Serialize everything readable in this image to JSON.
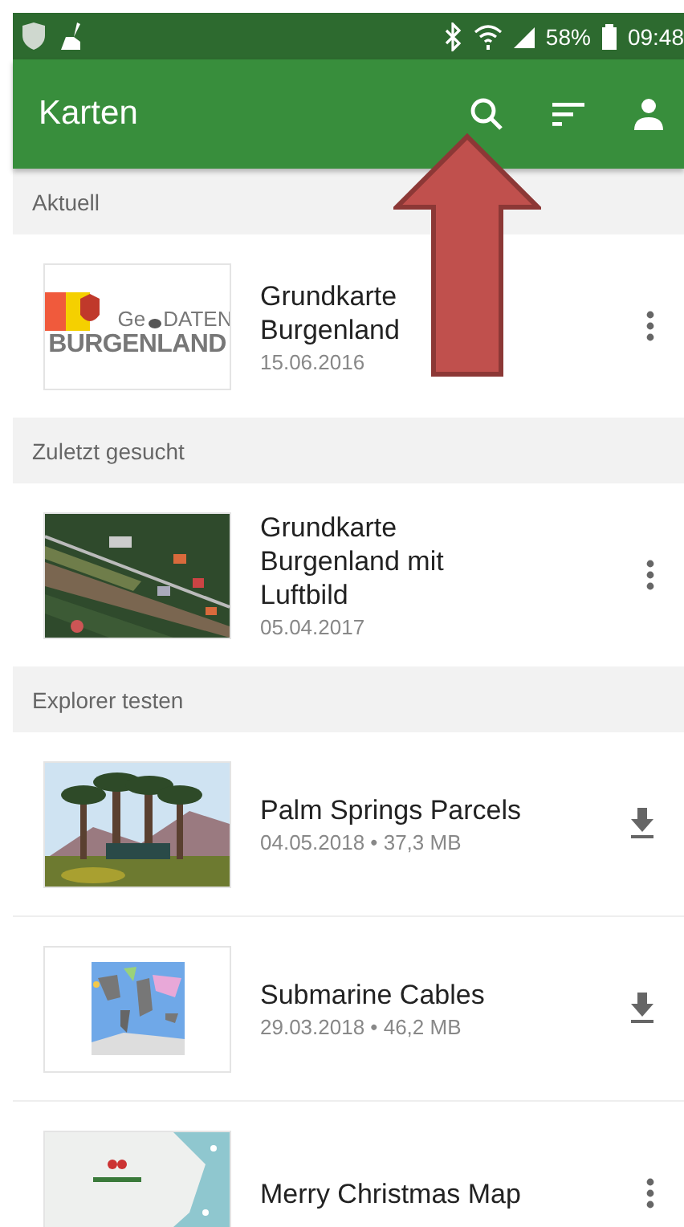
{
  "status_bar": {
    "battery": "58%",
    "time": "09:48"
  },
  "app_bar": {
    "title": "Karten"
  },
  "sections": [
    {
      "header": "Aktuell",
      "items": [
        {
          "title": "Grundkarte\nBurgenland",
          "subtitle": "15.06.2016",
          "kind": "menu",
          "thumbnail": {
            "kind": "logo",
            "top_left": "Ge",
            "top_right": "DATEN",
            "bottom": "BURGENLAND"
          }
        }
      ]
    },
    {
      "header": "Zuletzt gesucht",
      "items": [
        {
          "title": "Grundkarte\nBurgenland mit\nLuftbild",
          "subtitle": "05.04.2017",
          "kind": "menu",
          "thumbnail": {
            "kind": "aerial"
          }
        }
      ]
    },
    {
      "header": "Explorer testen",
      "items": [
        {
          "title": "Palm Springs Parcels",
          "subtitle": "04.05.2018 • 37,3 MB",
          "kind": "download",
          "thumbnail": {
            "kind": "palms"
          }
        },
        {
          "title": "Submarine Cables",
          "subtitle": "29.03.2018 • 46,2 MB",
          "kind": "download",
          "thumbnail": {
            "kind": "worldmap"
          }
        },
        {
          "title": "Merry Christmas Map",
          "kind": "menu",
          "thumbnail": {
            "kind": "snowmap"
          }
        }
      ]
    }
  ]
}
